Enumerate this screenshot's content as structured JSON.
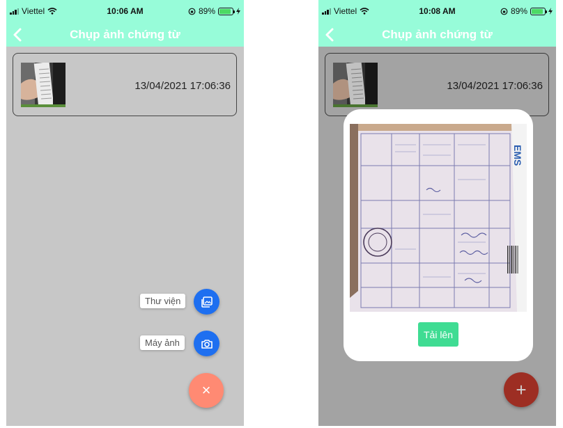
{
  "screens": [
    {
      "status": {
        "carrier": "Viettel",
        "time": "10:06 AM",
        "battery": "89%",
        "battery_level": 0.89
      },
      "nav": {
        "title": "Chụp ảnh chứng từ"
      },
      "document": {
        "timestamp": "13/04/2021 17:06:36"
      },
      "fab_menu": {
        "library_label": "Thư viện",
        "camera_label": "Máy ảnh",
        "close_symbol": "×"
      }
    },
    {
      "status": {
        "carrier": "Viettel",
        "time": "10:08 AM",
        "battery": "89%",
        "battery_level": 0.89
      },
      "nav": {
        "title": "Chụp ảnh chứng từ"
      },
      "document": {
        "timestamp": "13/04/2021 17:06:36"
      },
      "modal": {
        "upload_label": "Tải lên",
        "preview_logo": "EMS"
      },
      "fab": {
        "symbol": "+"
      }
    }
  ],
  "colors": {
    "header_bg": "#97fcd9",
    "content_bg": "#c7c7c7",
    "fab_action": "#1e6ff0",
    "fab_close": "#ff8a73",
    "fab_add": "#c0392b",
    "upload_button": "#3fdc93"
  },
  "icons": [
    "back-chevron-icon",
    "wifi-icon",
    "orientation-lock-icon",
    "charging-icon",
    "gallery-icon",
    "camera-icon",
    "close-icon",
    "plus-icon"
  ]
}
